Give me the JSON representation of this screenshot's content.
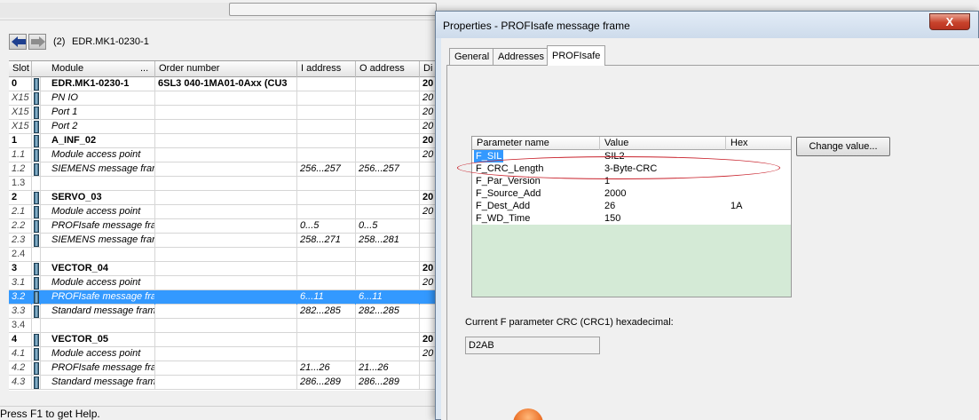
{
  "background_app": {
    "nav": {
      "back_icon": "back-arrow-icon",
      "forward_icon": "forward-arrow-icon",
      "slot_label": "(2)",
      "station_name": "EDR.MK1-0230-1"
    },
    "columns": [
      "Slot",
      "Module",
      "Order number",
      "I address",
      "O address",
      "Di"
    ],
    "module_header_ellipsis": "...",
    "rows": [
      {
        "slot": "0",
        "module": "EDR.MK1-0230-1",
        "order": "6SL3 040-1MA01-0Axx (CU3",
        "iaddr": "",
        "oaddr": "",
        "di": "20",
        "style": "bold"
      },
      {
        "slot": "X15",
        "module": "PN IO",
        "order": "",
        "iaddr": "",
        "oaddr": "",
        "di": "20",
        "style": "italic"
      },
      {
        "slot": "X15",
        "module": "Port 1",
        "order": "",
        "iaddr": "",
        "oaddr": "",
        "di": "20",
        "style": "italic"
      },
      {
        "slot": "X15",
        "module": "Port 2",
        "order": "",
        "iaddr": "",
        "oaddr": "",
        "di": "20",
        "style": "italic"
      },
      {
        "slot": "1",
        "module": "A_INF_02",
        "order": "",
        "iaddr": "",
        "oaddr": "",
        "di": "20",
        "style": "bold"
      },
      {
        "slot": "1.1",
        "module": "Module access point",
        "order": "",
        "iaddr": "",
        "oaddr": "",
        "di": "20",
        "style": "italic"
      },
      {
        "slot": "1.2",
        "module": "SIEMENS message fram",
        "order": "",
        "iaddr": "256...257",
        "oaddr": "256...257",
        "di": "",
        "style": "italic"
      },
      {
        "slot": "1.3",
        "module": "",
        "order": "",
        "iaddr": "",
        "oaddr": "",
        "di": "",
        "style": "empty"
      },
      {
        "slot": "2",
        "module": "SERVO_03",
        "order": "",
        "iaddr": "",
        "oaddr": "",
        "di": "20",
        "style": "bold"
      },
      {
        "slot": "2.1",
        "module": "Module access point",
        "order": "",
        "iaddr": "",
        "oaddr": "",
        "di": "20",
        "style": "italic"
      },
      {
        "slot": "2.2",
        "module": "PROFIsafe message fra",
        "order": "",
        "iaddr": "0...5",
        "oaddr": "0...5",
        "di": "",
        "style": "italic"
      },
      {
        "slot": "2.3",
        "module": "SIEMENS message fran",
        "order": "",
        "iaddr": "258...271",
        "oaddr": "258...281",
        "di": "",
        "style": "italic"
      },
      {
        "slot": "2.4",
        "module": "",
        "order": "",
        "iaddr": "",
        "oaddr": "",
        "di": "",
        "style": "empty"
      },
      {
        "slot": "3",
        "module": "VECTOR_04",
        "order": "",
        "iaddr": "",
        "oaddr": "",
        "di": "20",
        "style": "bold"
      },
      {
        "slot": "3.1",
        "module": "Module access point",
        "order": "",
        "iaddr": "",
        "oaddr": "",
        "di": "20",
        "style": "italic"
      },
      {
        "slot": "3.2",
        "module": "PROFIsafe message fra",
        "order": "",
        "iaddr": "6...11",
        "oaddr": "6...11",
        "di": "",
        "style": "selected"
      },
      {
        "slot": "3.3",
        "module": "Standard message fram",
        "order": "",
        "iaddr": "282...285",
        "oaddr": "282...285",
        "di": "",
        "style": "italic"
      },
      {
        "slot": "3.4",
        "module": "",
        "order": "",
        "iaddr": "",
        "oaddr": "",
        "di": "",
        "style": "empty"
      },
      {
        "slot": "4",
        "module": "VECTOR_05",
        "order": "",
        "iaddr": "",
        "oaddr": "",
        "di": "20",
        "style": "bold"
      },
      {
        "slot": "4.1",
        "module": "Module access point",
        "order": "",
        "iaddr": "",
        "oaddr": "",
        "di": "20",
        "style": "italic"
      },
      {
        "slot": "4.2",
        "module": "PROFIsafe message fra",
        "order": "",
        "iaddr": "21...26",
        "oaddr": "21...26",
        "di": "",
        "style": "italic"
      },
      {
        "slot": "4.3",
        "module": "Standard message fram",
        "order": "",
        "iaddr": "286...289",
        "oaddr": "286...289",
        "di": "",
        "style": "italic"
      }
    ],
    "status_text": "Press F1 to get Help."
  },
  "dialog": {
    "title": "Properties - PROFIsafe message frame",
    "close_label": "X",
    "tabs": [
      {
        "label": "General",
        "active": false
      },
      {
        "label": "Addresses",
        "active": false
      },
      {
        "label": "PROFIsafe",
        "active": true
      }
    ],
    "param_table": {
      "headers": {
        "name": "Parameter name",
        "value": "Value",
        "hex": "Hex"
      },
      "rows": [
        {
          "name": "F_SIL",
          "value": "SIL2",
          "hex": "",
          "selected": true
        },
        {
          "name": "F_CRC_Length",
          "value": "3-Byte-CRC",
          "hex": ""
        },
        {
          "name": "F_Par_Version",
          "value": "1",
          "hex": ""
        },
        {
          "name": "F_Source_Add",
          "value": "2000",
          "hex": ""
        },
        {
          "name": "F_Dest_Add",
          "value": "26",
          "hex": "1A",
          "highlighted": true
        },
        {
          "name": "F_WD_Time",
          "value": "150",
          "hex": ""
        }
      ]
    },
    "change_button": "Change value...",
    "crc_label": "Current F parameter CRC (CRC1) hexadecimal:",
    "crc_value": "D2AB"
  },
  "colors": {
    "selection": "#3399ff",
    "param_table_bg": "#d4ead6",
    "annotation": "#c8202a"
  }
}
